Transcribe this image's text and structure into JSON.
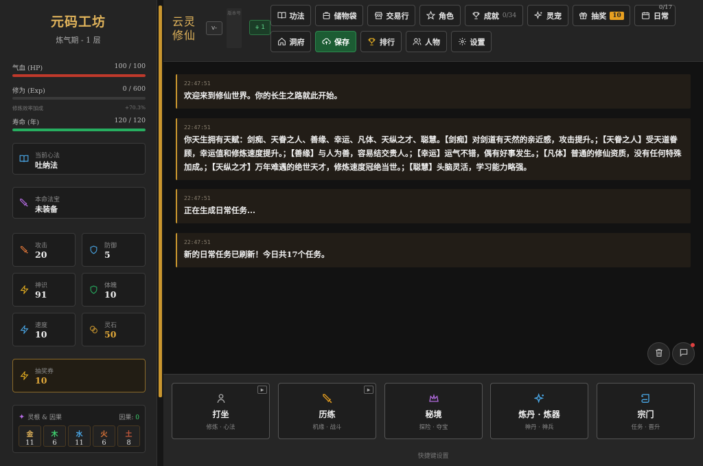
{
  "app": {
    "title": "元码工坊",
    "realm": "炼气期 - 1 层"
  },
  "stats": {
    "hp": {
      "label": "气血 (HP)",
      "value": "100 / 100",
      "fraction": 1.0,
      "color": "#c0392b"
    },
    "exp": {
      "label": "修为 (Exp)",
      "value": "0 / 600",
      "fraction": 0.0,
      "color": "#c9962f"
    },
    "exp_note": {
      "label": "修炼效率加成",
      "value": "+70.3%"
    },
    "life": {
      "label": "寿命 (年)",
      "value": "120 / 120",
      "fraction": 1.0,
      "color": "#27ae60"
    }
  },
  "technique": {
    "label": "当前心法",
    "value": "吐纳法"
  },
  "treasure": {
    "label": "本命法宝",
    "value": "未装备"
  },
  "attrs": [
    {
      "label": "攻击",
      "value": "20"
    },
    {
      "label": "防御",
      "value": "5"
    },
    {
      "label": "神识",
      "value": "91"
    },
    {
      "label": "体魄",
      "value": "10"
    },
    {
      "label": "速度",
      "value": "10"
    },
    {
      "label": "灵石",
      "value": "50"
    }
  ],
  "ticket": {
    "label": "抽奖券",
    "value": "10"
  },
  "roots": {
    "title": "灵根 & 因果",
    "karma_label": "因果:",
    "karma_value": "0",
    "items": [
      {
        "element": "金",
        "value": "11",
        "color": "#e0b35b"
      },
      {
        "element": "木",
        "value": "6",
        "color": "#3ecf6e"
      },
      {
        "element": "水",
        "value": "11",
        "color": "#4aa8e8"
      },
      {
        "element": "火",
        "value": "6",
        "color": "#e87a3a"
      },
      {
        "element": "土",
        "value": "8",
        "color": "#c0563a"
      }
    ]
  },
  "header": {
    "logo_line1": "云灵",
    "logo_line2": "修仙",
    "version": "v-",
    "version_text": "版本号",
    "level_badge": "1",
    "nav": [
      {
        "label": "功法"
      },
      {
        "label": "储物袋"
      },
      {
        "label": "交易行"
      },
      {
        "label": "角色"
      },
      {
        "label": "成就",
        "count": "0/34"
      },
      {
        "label": "灵宠"
      },
      {
        "label": "抽奖",
        "badge": "10"
      },
      {
        "label": "日常",
        "corner": "0/17"
      },
      {
        "label": "洞府"
      },
      {
        "label": "保存"
      },
      {
        "label": "排行"
      },
      {
        "label": "人物"
      },
      {
        "label": "设置"
      }
    ]
  },
  "log": [
    {
      "time": "22:47:51",
      "text": "欢迎来到修仙世界。你的长生之路就此开始。"
    },
    {
      "time": "22:47:51",
      "text": "你天生拥有天赋：剑痴、天眷之人、善缘、幸运、凡体、天纵之才、聪慧。【剑痴】对剑道有天然的亲近感，攻击提升。；【天眷之人】受天道眷顾，幸运值和修炼速度提升。；【善缘】与人为善，容易结交贵人。；【幸运】运气不错，偶有好事发生。；【凡体】普通的修仙资质，没有任何特殊加成。；【天纵之才】万年难遇的绝世天才，修炼速度冠绝当世。；【聪慧】头脑灵活，学习能力略强。"
    },
    {
      "time": "22:47:51",
      "text": "正在生成日常任务..."
    },
    {
      "time": "22:47:51",
      "text": "新的日常任务已刷新！今日共17个任务。"
    }
  ],
  "actions": [
    {
      "title": "打坐",
      "sub": "修炼 · 心法"
    },
    {
      "title": "历练",
      "sub": "机缘 · 战斗"
    },
    {
      "title": "秘境",
      "sub": "探险 · 夺宝"
    },
    {
      "title": "炼丹 · 炼器",
      "sub": "神丹 · 神兵"
    },
    {
      "title": "宗门",
      "sub": "任务 · 晋升"
    }
  ],
  "quick_settings": "快捷键设置"
}
